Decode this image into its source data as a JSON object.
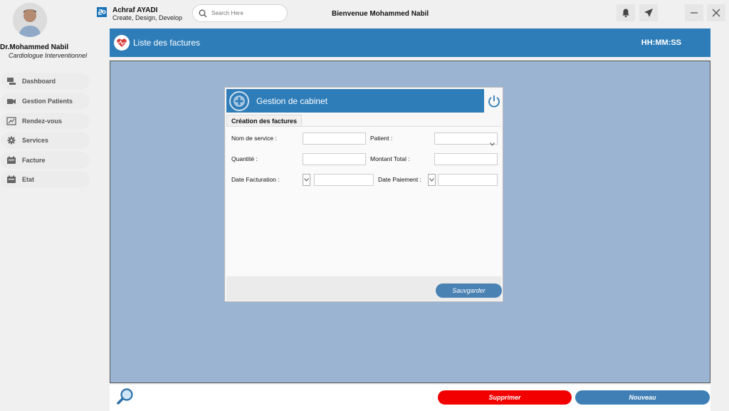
{
  "user": {
    "name": "Dr.Mohammed Nabil",
    "title": "Cardiologue Interventionnel"
  },
  "brand": {
    "name": "Achraf AYADI",
    "tagline": "Create, Design, Develop"
  },
  "search": {
    "placeholder": "Search Here"
  },
  "welcome": "Bienvenue Mohammed Nabil",
  "sidebar": {
    "items": [
      {
        "label": "Dashboard",
        "icon": "dashboard-icon"
      },
      {
        "label": "Gestion Patients",
        "icon": "patients-icon"
      },
      {
        "label": "Rendez-vous",
        "icon": "calendar-icon"
      },
      {
        "label": "Services",
        "icon": "gear-icon"
      },
      {
        "label": "Facture",
        "icon": "invoice-icon"
      },
      {
        "label": "Etat",
        "icon": "report-icon"
      }
    ]
  },
  "header": {
    "title": "Liste des factures",
    "clock": "HH:MM:SS",
    "icon": "heart-pulse-icon"
  },
  "dialog": {
    "title": "Gestion de cabinet",
    "tab": "Création des factures",
    "fields": {
      "service_label": "Nom de service :",
      "service_value": "",
      "patient_label": "Patient :",
      "patient_value": "",
      "quantity_label": "Quantité :",
      "quantity_value": "",
      "total_label": "Montant Total :",
      "total_value": "",
      "invoice_date_label": "Date Facturation :",
      "invoice_date_value": "",
      "payment_date_label": "Date Paiement :",
      "payment_date_value": ""
    },
    "save_label": "Sauvgarder"
  },
  "actions": {
    "delete_label": "Supprimer",
    "new_label": "Nouveau"
  },
  "colors": {
    "primary": "#2e7db9",
    "main_bg": "#9ab4d2",
    "danger": "#f20000"
  }
}
